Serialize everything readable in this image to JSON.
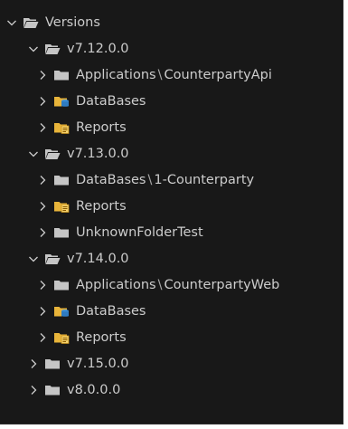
{
  "tree": {
    "root": {
      "label": "Versions",
      "icon": "folder-open-icon",
      "expanded": true
    },
    "versions": [
      {
        "label": "v7.12.0.0",
        "expanded": true,
        "children": [
          {
            "parts": [
              "Applications",
              "CounterpartyApi"
            ],
            "icon": "folder-icon"
          },
          {
            "parts": [
              "DataBases"
            ],
            "icon": "database-folder-icon"
          },
          {
            "parts": [
              "Reports"
            ],
            "icon": "reports-folder-icon"
          }
        ]
      },
      {
        "label": "v7.13.0.0",
        "expanded": true,
        "children": [
          {
            "parts": [
              "DataBases",
              "1-Counterparty"
            ],
            "icon": "folder-icon"
          },
          {
            "parts": [
              "Reports"
            ],
            "icon": "reports-folder-icon"
          },
          {
            "parts": [
              "UnknownFolderTest"
            ],
            "icon": "folder-icon"
          }
        ]
      },
      {
        "label": "v7.14.0.0",
        "expanded": true,
        "children": [
          {
            "parts": [
              "Applications",
              "CounterpartyWeb"
            ],
            "icon": "folder-icon"
          },
          {
            "parts": [
              "DataBases"
            ],
            "icon": "database-folder-icon"
          },
          {
            "parts": [
              "Reports"
            ],
            "icon": "reports-folder-icon"
          }
        ]
      },
      {
        "label": "v7.15.0.0",
        "expanded": false,
        "children": []
      },
      {
        "label": "v8.0.0.0",
        "expanded": false,
        "children": []
      }
    ]
  },
  "colors": {
    "background": "#181818",
    "text": "#cccccc",
    "folder": "#c5c5c5",
    "database_folder": "#e8b43a",
    "reports_folder": "#e8b43a"
  }
}
